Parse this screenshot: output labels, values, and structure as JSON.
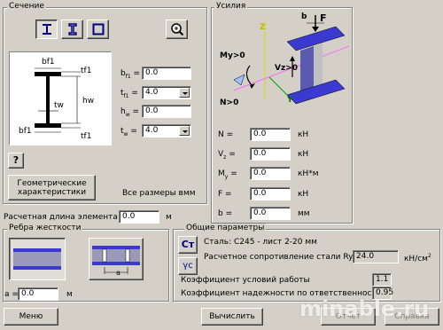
{
  "section": {
    "title": "Сечение",
    "shape_icons": [
      "i-beam-icon",
      "channel-icon",
      "box-section-icon"
    ],
    "fields": [
      {
        "label": "b",
        "sub": "f1",
        "value": "0.0",
        "type": "input"
      },
      {
        "label": "t",
        "sub": "f1",
        "value": "4.0",
        "type": "combo"
      },
      {
        "label": "h",
        "sub": "w",
        "value": "0.0",
        "type": "input"
      },
      {
        "label": "t",
        "sub": "w",
        "value": "4.0",
        "type": "combo"
      }
    ],
    "diagram_labels": {
      "bf1_top": "bf1",
      "tf1_top": "tf1",
      "tw": "tw",
      "hw": "hw",
      "bf1_bottom": "bf1",
      "tf1_bottom": "tf1"
    },
    "help_label": "?",
    "geom_button": "Геометрические характеристики",
    "units_note": "Все размеры в",
    "units": "мм"
  },
  "forces": {
    "title": "Усилия",
    "rows": [
      {
        "label": "N =",
        "value": "0.0",
        "unit": "кН"
      },
      {
        "label": "V",
        "sub": "z",
        "label_suffix": " =",
        "value": "0.0",
        "unit": "кН"
      },
      {
        "label": "M",
        "sub": "y",
        "label_suffix": " =",
        "value": "0.0",
        "unit": "кН*м"
      },
      {
        "label": "F =",
        "value": "0.0",
        "unit": "кН"
      },
      {
        "label": "b =",
        "value": "0.0",
        "unit": "мм"
      }
    ],
    "diagram_labels": {
      "b": "b",
      "F": "F",
      "My": "My>0",
      "Vz": "Vz>0",
      "N": "N>0",
      "Y": "Y",
      "Z": "Z"
    }
  },
  "length": {
    "label": "Расчетная длина элемента L =",
    "value": "0.0",
    "unit": "м"
  },
  "stiffeners": {
    "title": "Ребра жесткости",
    "a_label": "a =",
    "a_value": "0.0",
    "a_unit": "м",
    "diagram_a": "a"
  },
  "params": {
    "title": "Общие параметры",
    "steel_button": "Ст",
    "gamma_button": "γс",
    "steel": "Сталь: С245 - лист 2-20 мм",
    "ry_label": "Расчетное сопротивление стали Ry",
    "ry_value": "24.0",
    "ry_unit": "кН/см",
    "ry_unit_sup": "2",
    "cond_label": "Коэффициент условий работы",
    "cond_value": "1.1",
    "rel_label": "Коэффициент надежности по ответственности",
    "rel_value": "0.95"
  },
  "bottom": {
    "menu": "Меню",
    "calc": "Вычислить",
    "report": "Отчет",
    "help": "Справка"
  },
  "watermark": "minable.ru"
}
